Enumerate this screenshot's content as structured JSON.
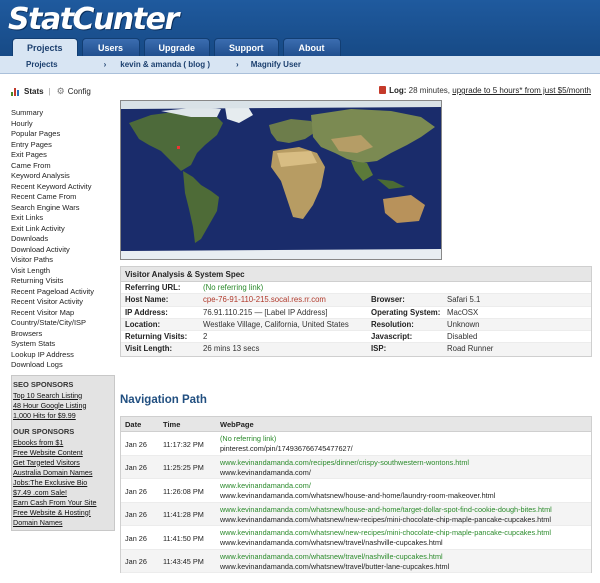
{
  "header": {
    "logo_left": "Stat",
    "logo_right": "unter",
    "tabs": [
      "Projects",
      "Users",
      "Upgrade",
      "Support",
      "About"
    ]
  },
  "subnav": {
    "projects": "Projects",
    "project_name": "kevin & amanda ( blog )",
    "magnify_user": "Magnify User"
  },
  "toolbar": {
    "stats": "Stats",
    "config": "Config",
    "log_label": "Log:",
    "log_text": " 28 minutes, ",
    "upgrade_link": "upgrade to 5 hours* from just $5/month"
  },
  "sidebar": {
    "items": [
      "Summary",
      "Hourly",
      "Popular Pages",
      "Entry Pages",
      "Exit Pages",
      "Came From",
      "Keyword Analysis",
      "Recent Keyword Activity",
      "Recent Came From",
      "Search Engine Wars",
      "Exit Links",
      "Exit Link Activity",
      "Downloads",
      "Download Activity",
      "Visitor Paths",
      "Visit Length",
      "Returning Visits",
      "Recent Pageload Activity",
      "Recent Visitor Activity",
      "Recent Visitor Map",
      "Country/State/City/ISP",
      "Browsers",
      "System Stats",
      "Lookup IP Address",
      "Download Logs"
    ],
    "seo_title": "SEO SPONSORS",
    "seo_links": [
      "Top 10 Search Listing",
      "48 Hour Google Listing",
      "1,000 Hits for $9.99"
    ],
    "our_title": "OUR SPONSORS",
    "our_links": [
      "Ebooks from $1",
      "Free Website Content",
      "Get Targeted Visitors",
      "Australia Domain Names",
      "Jobs:The Exclusive Bio",
      "$7.49 .com Sale!",
      "Earn Cash From Your Site",
      "Free Website & Hosting!",
      "Domain Names"
    ]
  },
  "visitor": {
    "title": "Visitor Analysis & System Spec",
    "referring_label": "Referring URL:",
    "referring_value": "(No referring link)",
    "host_label": "Host Name:",
    "host_value": "cpe-76-91-110-215.socal.res.rr.com",
    "browser_label": "Browser:",
    "browser_value": "Safari 5.1",
    "ip_label": "IP Address:",
    "ip_value": "76.91.110.215 — [Label IP Address]",
    "os_label": "Operating System:",
    "os_value": "MacOSX",
    "location_label": "Location:",
    "location_value": "Westlake Village, California, United States",
    "resolution_label": "Resolution:",
    "resolution_value": "Unknown",
    "returning_label": "Returning Visits:",
    "returning_value": "2",
    "javascript_label": "Javascript:",
    "javascript_value": "Disabled",
    "length_label": "Visit Length:",
    "length_value": "26 mins 13 secs",
    "isp_label": "ISP:",
    "isp_value": "Road Runner"
  },
  "navigation": {
    "title": "Navigation Path",
    "headers": [
      "Date",
      "Time",
      "WebPage"
    ],
    "rows": [
      {
        "date": "Jan 26",
        "time": "11:17:32 PM",
        "ref": "(No referring link)",
        "page": "pinterest.com/pin/174936766745477627/"
      },
      {
        "date": "Jan 26",
        "time": "11:25:25 PM",
        "ref": "www.kevinandamanda.com/recipes/dinner/crispy-southwestern-wontons.html",
        "page": "www.kevinandamanda.com/"
      },
      {
        "date": "Jan 26",
        "time": "11:26:08 PM",
        "ref": "www.kevinandamanda.com/",
        "page": "www.kevinandamanda.com/whatsnew/house-and-home/laundry-room-makeover.html"
      },
      {
        "date": "Jan 26",
        "time": "11:41:28 PM",
        "ref": "www.kevinandamanda.com/whatsnew/house-and-home/target-dollar-spot-find-cookie-dough-bites.html",
        "page": "www.kevinandamanda.com/whatsnew/new-recipes/mini-chocolate-chip-maple-pancake-cupcakes.html"
      },
      {
        "date": "Jan 26",
        "time": "11:41:50 PM",
        "ref": "www.kevinandamanda.com/whatsnew/new-recipes/mini-chocolate-chip-maple-pancake-cupcakes.html",
        "page": "www.kevinandamanda.com/whatsnew/travel/nashville-cupcakes.html"
      },
      {
        "date": "Jan 26",
        "time": "11:43:45 PM",
        "ref": "www.kevinandamanda.com/whatsnew/travel/nashville-cupcakes.html",
        "page": "www.kevinandamanda.com/whatsnew/travel/butter-lane-cupcakes.html"
      }
    ]
  },
  "colors": {
    "header": "#1f5a9e",
    "map_ocean": "#1a2c6b",
    "visitor_marker": "#e33333"
  }
}
